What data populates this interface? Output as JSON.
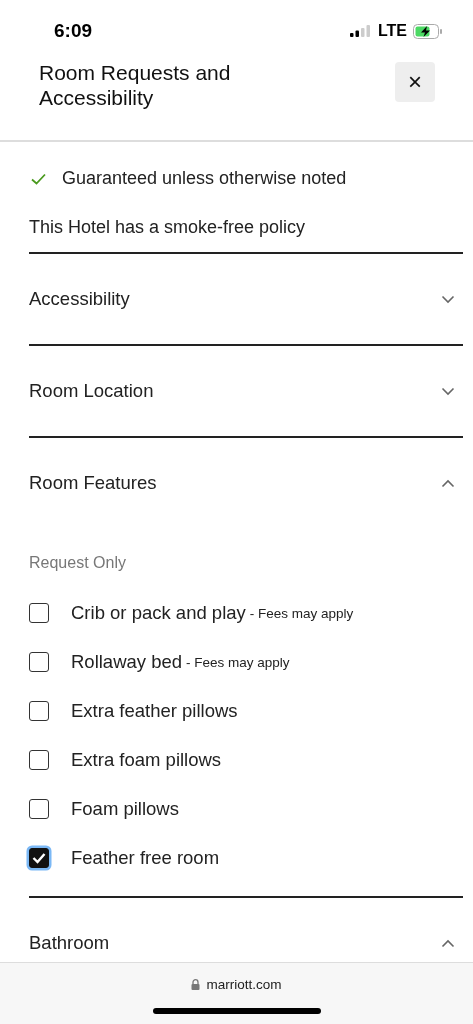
{
  "status_bar": {
    "time": "6:09",
    "network": "LTE"
  },
  "header": {
    "title": "Room Requests and Accessibility",
    "close": "×"
  },
  "notes": [
    {
      "kind": "check",
      "text": "Guaranteed unless otherwise noted"
    },
    {
      "kind": "plain",
      "text": "This Hotel has a smoke-free policy"
    }
  ],
  "sections": [
    {
      "title": "Accessibility",
      "expanded": false
    },
    {
      "title": "Room Location",
      "expanded": false
    },
    {
      "title": "Room Features",
      "expanded": true,
      "subtitle": "Request Only",
      "options": [
        {
          "label": "Crib or pack and play",
          "note": "- Fees may apply",
          "checked": false
        },
        {
          "label": "Rollaway bed",
          "note": "- Fees may apply",
          "checked": false
        },
        {
          "label": "Extra feather pillows",
          "checked": false
        },
        {
          "label": "Extra foam pillows",
          "checked": false
        },
        {
          "label": "Foam pillows",
          "checked": false
        },
        {
          "label": "Feather free room",
          "checked": true
        }
      ]
    },
    {
      "title": "Bathroom",
      "expanded": true
    }
  ],
  "browser_bar": {
    "url": "marriott.com"
  }
}
